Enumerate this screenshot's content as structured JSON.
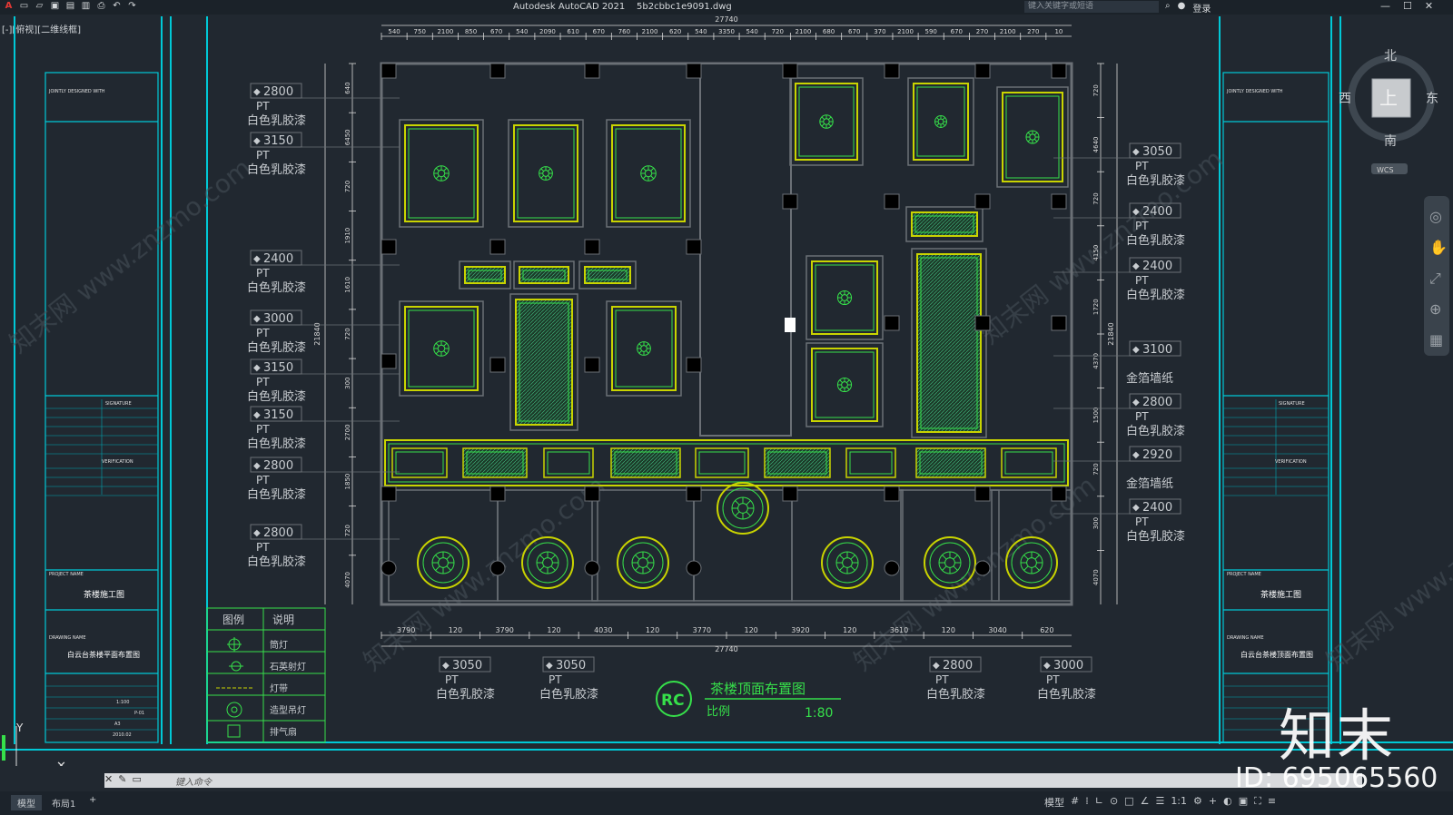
{
  "app": {
    "title": "Autodesk AutoCAD 2021",
    "file": "5b2cbbc1e9091.dwg",
    "search_placeholder": "键入关键字或短语",
    "login": "登录",
    "view_label": "[-][俯视][二维线框]",
    "command_placeholder": "键入命令",
    "tabs": [
      "模型",
      "布局1"
    ],
    "scale_readout": "1:1"
  },
  "viewcube": {
    "north": "北",
    "south": "南",
    "east": "东",
    "west": "西",
    "top": "上",
    "wcs": "WCS"
  },
  "drawing": {
    "overall_width": "27740",
    "top_dims": [
      "540",
      "750",
      "2100",
      "850",
      "670",
      "540",
      "2090",
      "610",
      "670",
      "760",
      "2100",
      "620",
      "540",
      "3350",
      "540",
      "720",
      "2100",
      "680",
      "670",
      "370",
      "2100",
      "590",
      "670",
      "270",
      "2100",
      "270",
      "10"
    ],
    "bottom_dims": [
      "3790",
      "120",
      "3790",
      "120",
      "4030",
      "120",
      "3770",
      "120",
      "3920",
      "120",
      "3610",
      "120",
      "3040",
      "620"
    ],
    "bottom_total": "27740",
    "left_dims": [
      "640",
      "6450",
      "720",
      "1910",
      "1610",
      "720",
      "300",
      "2700",
      "1850",
      "720",
      "4070"
    ],
    "left_total": "21840",
    "right_dims": [
      "720",
      "4640",
      "720",
      "4150",
      "1720",
      "4370",
      "1500",
      "720",
      "300",
      "4070"
    ],
    "right_total": "21840",
    "sheet_title": "茶楼顶面布置图",
    "scale_label": "比例",
    "scale_value": "1:80",
    "tag": "RC"
  },
  "left_labels": [
    {
      "h": "2800",
      "code": "PT",
      "mat": "白色乳胶漆"
    },
    {
      "h": "3150",
      "code": "PT",
      "mat": "白色乳胶漆"
    },
    {
      "h": "2400",
      "code": "PT",
      "mat": "白色乳胶漆"
    },
    {
      "h": "3000",
      "code": "PT",
      "mat": "白色乳胶漆"
    },
    {
      "h": "3150",
      "code": "PT",
      "mat": "白色乳胶漆"
    },
    {
      "h": "3150",
      "code": "PT",
      "mat": "白色乳胶漆"
    },
    {
      "h": "2800",
      "code": "PT",
      "mat": "白色乳胶漆"
    },
    {
      "h": "2800",
      "code": "PT",
      "mat": "白色乳胶漆"
    }
  ],
  "right_labels": [
    {
      "h": "3050",
      "code": "PT",
      "mat": "白色乳胶漆"
    },
    {
      "h": "2400",
      "code": "PT",
      "mat": "白色乳胶漆"
    },
    {
      "h": "2400",
      "code": "PT",
      "mat": "白色乳胶漆"
    },
    {
      "h": "3100",
      "code": "",
      "mat": "金箔墙纸"
    },
    {
      "h": "2800",
      "code": "PT",
      "mat": "白色乳胶漆"
    },
    {
      "h": "2920",
      "code": "",
      "mat": "金箔墙纸"
    },
    {
      "h": "2400",
      "code": "PT",
      "mat": "白色乳胶漆"
    }
  ],
  "bottom_labels": [
    {
      "h": "3050",
      "code": "PT",
      "mat": "白色乳胶漆"
    },
    {
      "h": "3050",
      "code": "PT",
      "mat": "白色乳胶漆"
    },
    {
      "h": "2800",
      "code": "PT",
      "mat": "白色乳胶漆"
    },
    {
      "h": "3000",
      "code": "PT",
      "mat": "白色乳胶漆"
    }
  ],
  "legend": {
    "head_symbol": "图例",
    "head_desc": "说明",
    "items": [
      "筒灯",
      "石英射灯",
      "灯带",
      "造型吊灯",
      "排气扇"
    ]
  },
  "title_blocks": {
    "left_project": "茶楼施工图",
    "left_drawing": "白云台茶楼平面布置图",
    "right_project": "茶楼施工图",
    "right_drawing": "白云台茶楼顶面布置图",
    "signature": "SIGNATURE",
    "verification": "VERIFICATION",
    "designed_with": "JOINTLY DESIGNED WITH",
    "project_name": "PROJECT NAME",
    "drawing_name": "DRAWING NAME",
    "scale": "1:100",
    "drawing_no": "P-01",
    "size": "A3",
    "date": "2010.02"
  },
  "watermark": {
    "logo": "知末",
    "id": "ID: 695065560",
    "site": "知末网 www.znzmo.com"
  },
  "colors": {
    "background": "#212830",
    "frame": "#00c8d6",
    "ceiling": "#c9d400",
    "fixture": "#36e04a",
    "dimension": "#d8d8d8",
    "wall": "#6b7076"
  }
}
